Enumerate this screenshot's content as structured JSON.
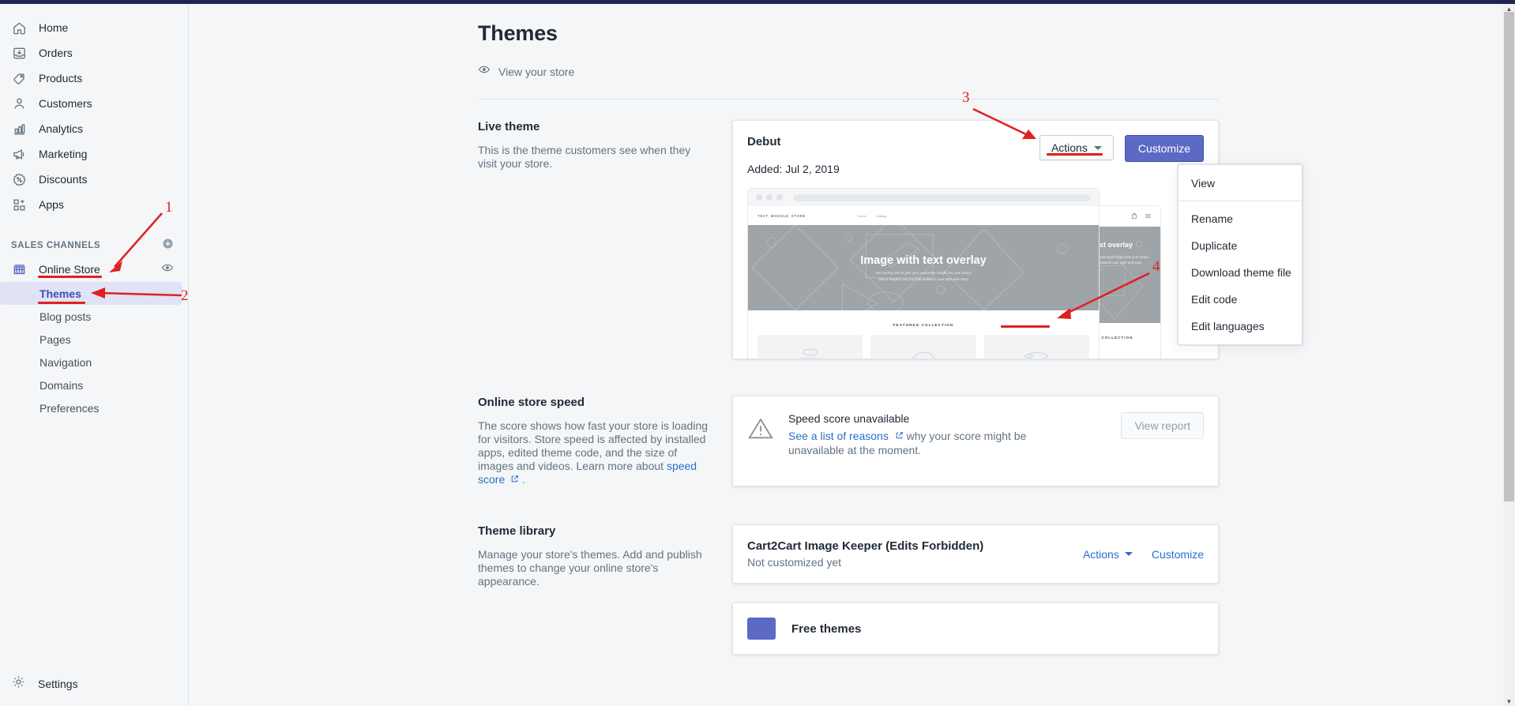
{
  "sidebar": {
    "nav": [
      {
        "label": "Home",
        "icon": "home-icon"
      },
      {
        "label": "Orders",
        "icon": "orders-icon"
      },
      {
        "label": "Products",
        "icon": "products-tag-icon"
      },
      {
        "label": "Customers",
        "icon": "customers-person-icon"
      },
      {
        "label": "Analytics",
        "icon": "analytics-bars-icon"
      },
      {
        "label": "Marketing",
        "icon": "marketing-megaphone-icon"
      },
      {
        "label": "Discounts",
        "icon": "discounts-percent-icon"
      },
      {
        "label": "Apps",
        "icon": "apps-grid-plus-icon"
      }
    ],
    "section_header": "SALES CHANNELS",
    "add_channel_icon": "plus-circle-icon",
    "channel": {
      "label": "Online Store",
      "icon": "storefront-icon",
      "view_icon": "eye-icon"
    },
    "sub_items": [
      {
        "label": "Themes",
        "active": true
      },
      {
        "label": "Blog posts",
        "active": false
      },
      {
        "label": "Pages",
        "active": false
      },
      {
        "label": "Navigation",
        "active": false
      },
      {
        "label": "Domains",
        "active": false
      },
      {
        "label": "Preferences",
        "active": false
      }
    ],
    "settings": {
      "label": "Settings",
      "icon": "gear-icon"
    }
  },
  "page": {
    "title": "Themes",
    "view_store": {
      "label": "View your store",
      "icon": "eye-icon"
    }
  },
  "live_theme": {
    "section_title": "Live theme",
    "section_desc": "This is the theme customers see when they visit your store.",
    "name": "Debut",
    "added": "Added: Jul 2, 2019",
    "actions_label": "Actions",
    "customize_label": "Customize",
    "preview": {
      "logo": "TEXT_MODULE_STORE",
      "nav": [
        "Home",
        "Catalog"
      ],
      "hero_title": "Image with text overlay",
      "hero_body_line1": "Use overlay text to give your customers insight into your brand.",
      "hero_body_line2": "Select imagery and text that relates to your style and story.",
      "featured_label": "FEATURED COLLECTION",
      "mobile_hero_title": "Image with text overlay",
      "mobile_hero_body": "Use overlay text to give your customers insight into your brand. Select imagery and text that relates to your style and story.",
      "mobile_featured_label": "FEATURED COLLECTION"
    }
  },
  "actions_menu": {
    "items": [
      {
        "label": "View",
        "separator_after": true
      },
      {
        "label": "Rename",
        "separator_after": false
      },
      {
        "label": "Duplicate",
        "separator_after": false
      },
      {
        "label": "Download theme file",
        "separator_after": false
      },
      {
        "label": "Edit code",
        "separator_after": false
      },
      {
        "label": "Edit languages",
        "separator_after": false
      }
    ]
  },
  "store_speed": {
    "section_title": "Online store speed",
    "section_desc_1": "The score shows how fast your store is loading for visitors. Store speed is affected by installed apps, edited theme code, and the size of images and videos. Learn more about ",
    "section_desc_link": "speed score",
    "section_desc_2": " .",
    "status_title": "Speed score unavailable",
    "status_link": "See a list of reasons",
    "status_rest": " why your score might be unavailable at the moment.",
    "view_report_label": "View report",
    "icon": "warning-triangle-icon",
    "external_icon": "external-link-icon"
  },
  "theme_library": {
    "section_title": "Theme library",
    "section_desc": "Manage your store's themes. Add and publish themes to change your online store's appearance.",
    "themes": [
      {
        "name": "Cart2Cart Image Keeper (Edits Forbidden)",
        "sub": "Not customized yet",
        "actions_label": "Actions",
        "customize_label": "Customize"
      }
    ],
    "free_themes_title": "Free themes"
  },
  "annotations": {
    "markers": [
      "1",
      "2",
      "3",
      "4"
    ],
    "color": "#e02020"
  }
}
